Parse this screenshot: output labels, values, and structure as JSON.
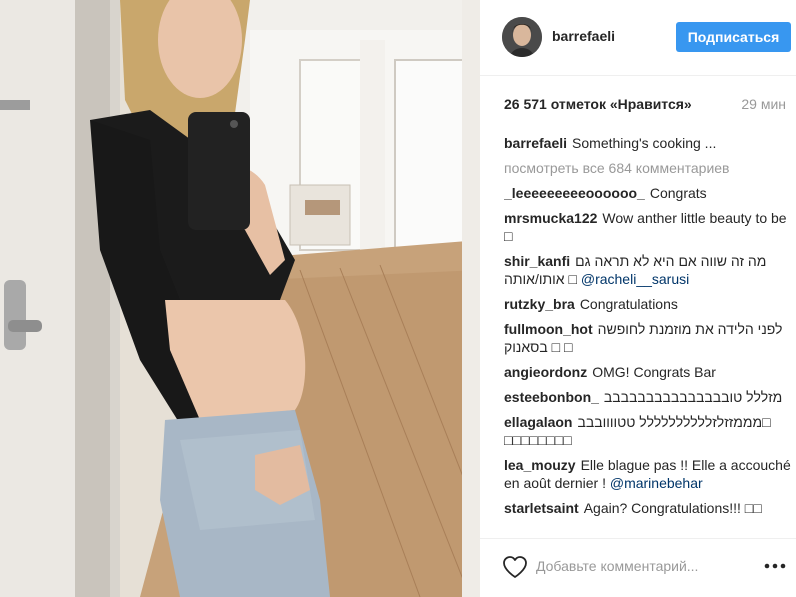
{
  "post": {
    "username": "barrefaeli",
    "follow_label": "Подписаться",
    "likes_text": "26 571 отметок «Нравится»",
    "time_ago": "29 мин"
  },
  "comments": {
    "caption": {
      "user": "barrefaeli",
      "text": "Something's cooking ..."
    },
    "view_all": "посмотреть все 684 комментариев",
    "items": [
      {
        "user": "_leeeeeeeeeoooooo_",
        "text": "Congrats"
      },
      {
        "user": "mrsmucka122",
        "text": "Wow anther little beauty to be □"
      },
      {
        "user": "shir_kanfi",
        "text": "מה זה שווה אם היא לא תראה גם אותו/אותה □",
        "mention": "@racheli__sarusi"
      },
      {
        "user": "rutzky_bra",
        "text": "Congratulations"
      },
      {
        "user": "fullmoon_hot",
        "text": "לפני הלידה את מוזמנת לחופשה בסאנוק □ □"
      },
      {
        "user": "angieordonz",
        "text": "OMG! Congrats Bar"
      },
      {
        "user": "esteebonbon_",
        "text": "מזללל טובבבבבבבבבבבבבבב"
      },
      {
        "user": "ellagalaon",
        "text": "מממזזלזלללללללללל טטוווובבב□ □□□□□□□□"
      },
      {
        "user": "lea_mouzy",
        "text": "Elle blague pas !! Elle a accouché en août dernier !",
        "mention": "@marinebehar"
      },
      {
        "user": "starletsaint",
        "text": "Again? Congratulations!!! □□"
      }
    ]
  },
  "footer": {
    "comment_placeholder": "Добавьте комментарий...",
    "icons": {
      "like": "heart-icon",
      "more": "more-options-icon"
    }
  },
  "colors": {
    "accent": "#3897f0",
    "text": "#262626",
    "muted": "#999999",
    "mention": "#003569"
  }
}
